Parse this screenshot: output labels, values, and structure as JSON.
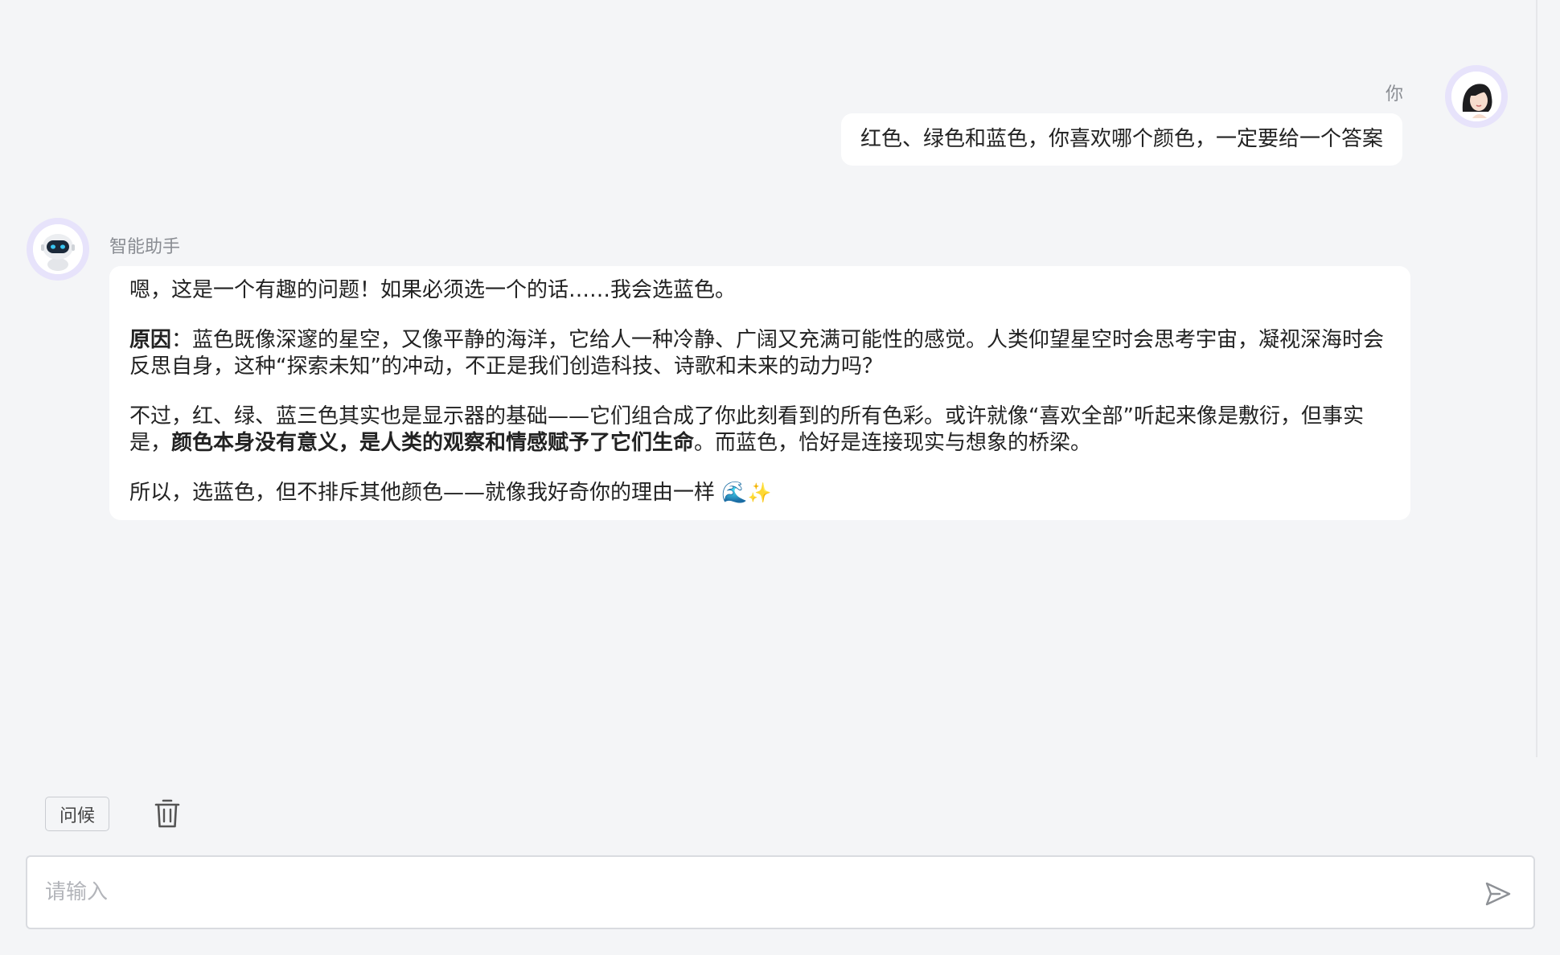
{
  "user": {
    "name": "你",
    "message": "红色、绿色和蓝色，你喜欢哪个颜色，一定要给一个答案"
  },
  "assistant": {
    "name": "智能助手",
    "p1": "嗯，这是一个有趣的问题！如果必须选一个的话……我会选蓝色。",
    "p2_bold": "原因",
    "p2_rest": "：蓝色既像深邃的星空，又像平静的海洋，它给人一种冷静、广阔又充满可能性的感觉。人类仰望星空时会思考宇宙，凝视深海时会反思自身，这种“探索未知”的冲动，不正是我们创造科技、诗歌和未来的动力吗？",
    "p3_a": "不过，红、绿、蓝三色其实也是显示器的基础——它们组合成了你此刻看到的所有色彩。或许就像“喜欢全部”听起来像是敷衍，但事实是，",
    "p3_bold": "颜色本身没有意义，是人类的观察和情感赋予了它们生命",
    "p3_b": "。而蓝色，恰好是连接现实与想象的桥梁。",
    "p4": "所以，选蓝色，但不排斥其他颜色——就像我好奇你的理由一样",
    "p4_emoji_1": "🌊",
    "p4_emoji_2": "✨"
  },
  "toolbar": {
    "greet_label": "问候",
    "clear_icon": "trash-icon"
  },
  "input": {
    "placeholder": "请输入",
    "value": "",
    "send_icon": "send-icon"
  },
  "colors": {
    "background": "#f4f5f7",
    "bubble": "#ffffff",
    "avatar_ring": "#e7e3fb"
  }
}
